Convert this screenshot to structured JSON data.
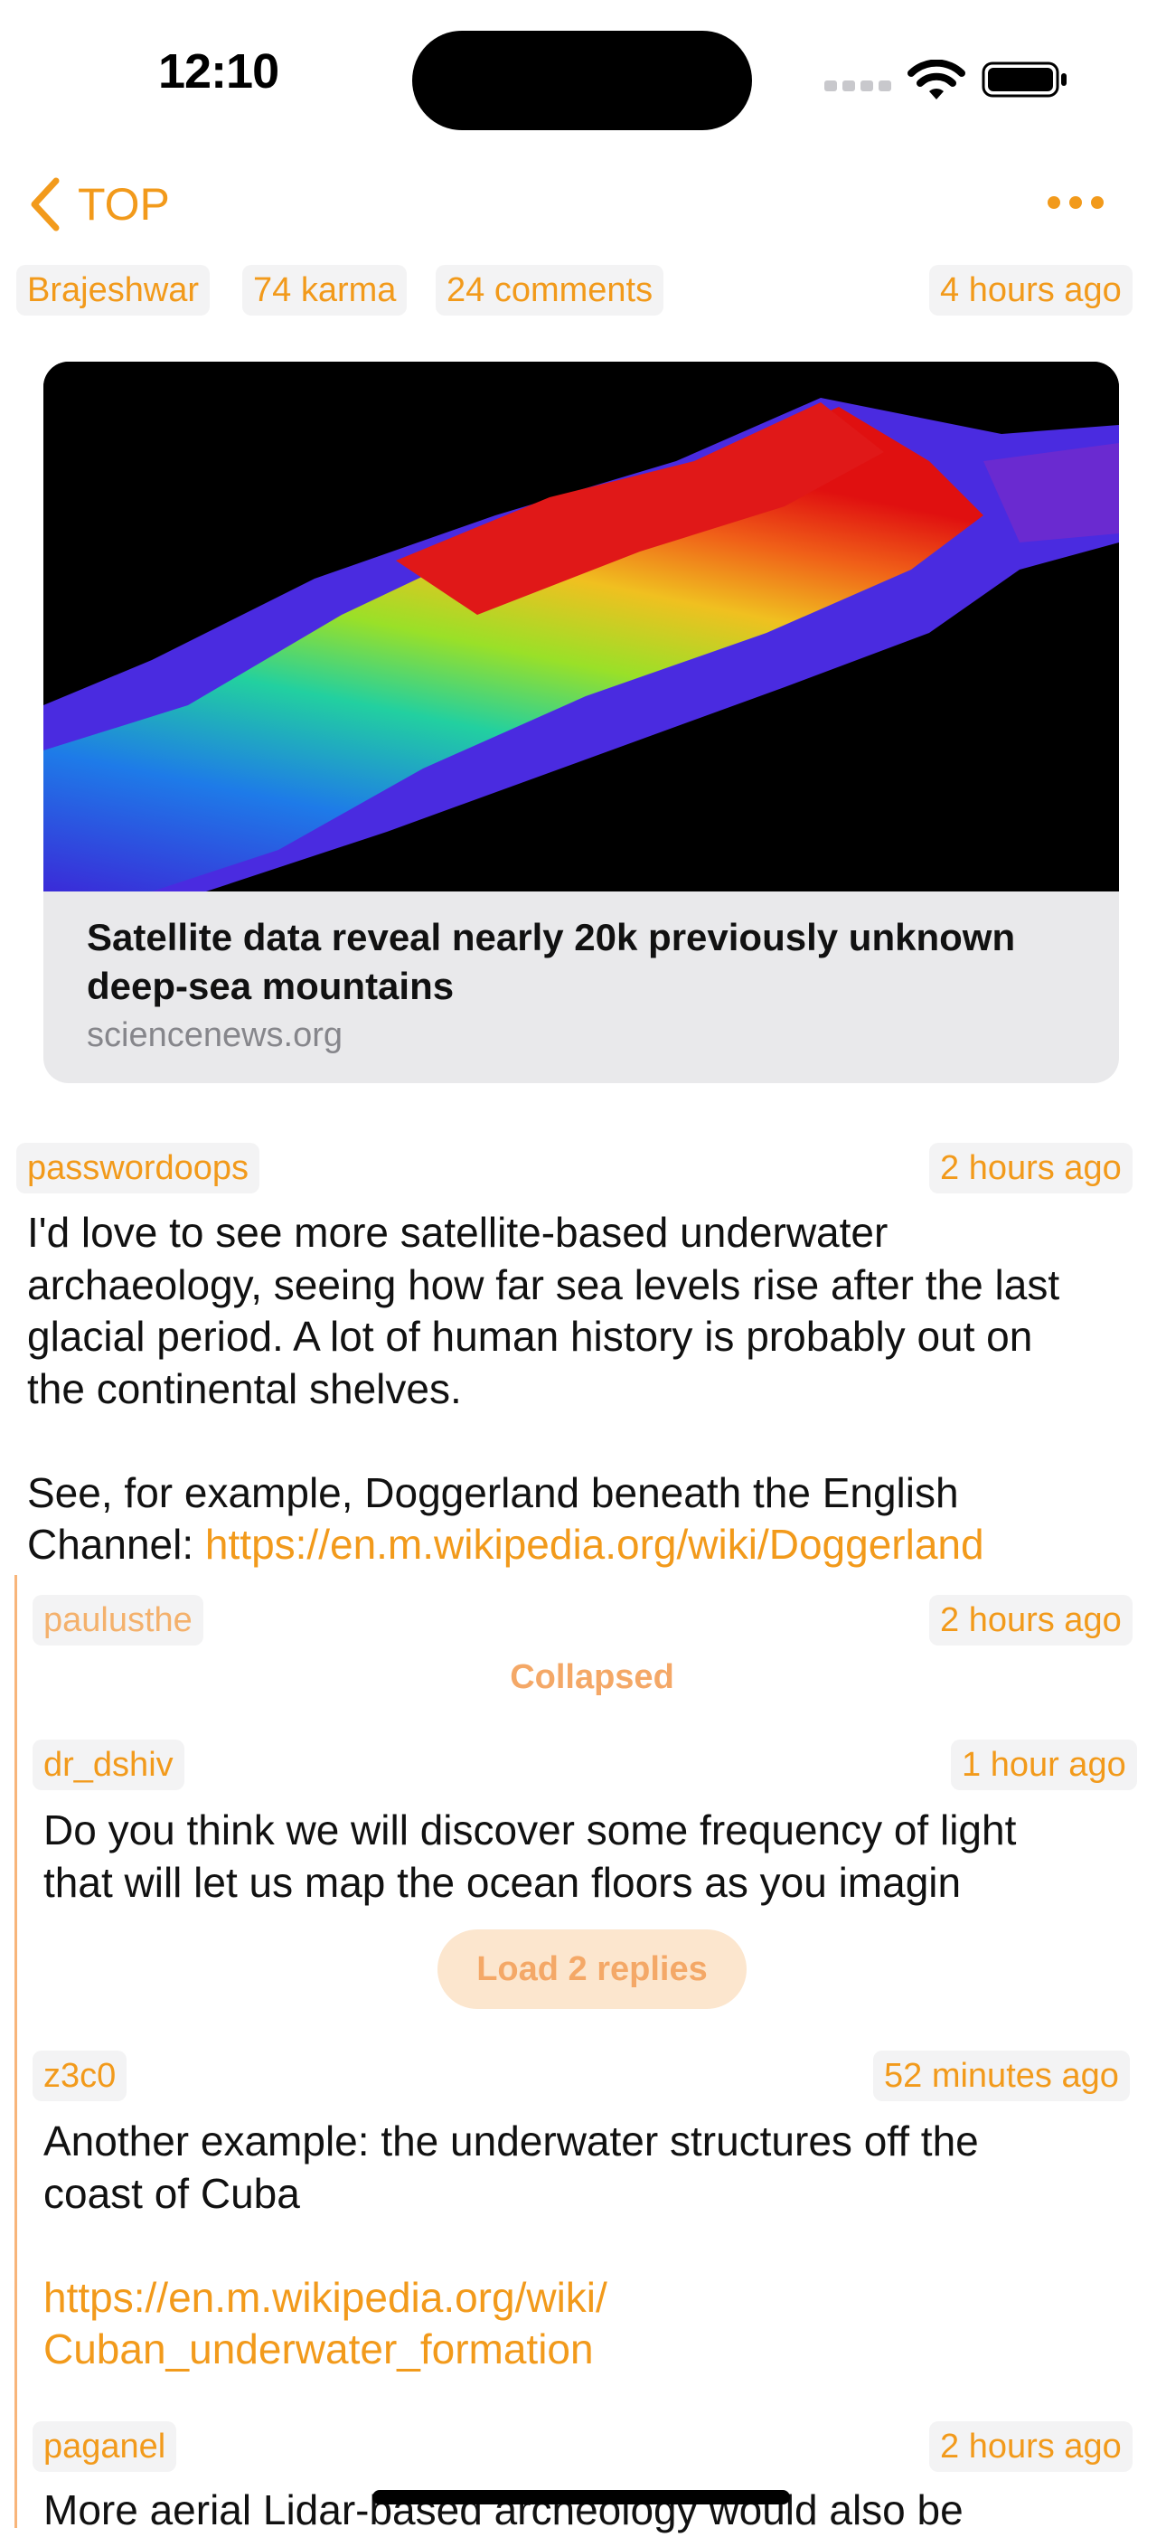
{
  "status_bar": {
    "time": "12:10"
  },
  "nav": {
    "back_label": "TOP"
  },
  "post": {
    "author": "Brajeshwar",
    "karma": "74 karma",
    "comments": "24 comments",
    "age": "4 hours ago",
    "link_title": "Satellite data reveal nearly 20k previously unknown deep-sea mountains",
    "link_domain": "sciencenews.org"
  },
  "comments": [
    {
      "author": "passwordoops",
      "age": "2 hours ago",
      "text_lines": [
        "I'd love to see more satellite-based underwater",
        "archaeology, seeing how far sea levels rise after the last",
        "glacial period. A lot of human history is probably out on",
        "the continental shelves.",
        "",
        "See, for example, Doggerland beneath the English"
      ],
      "last_line_prefix": "Channel: ",
      "link": "https://en.m.wikipedia.org/wiki/Doggerland"
    },
    {
      "author": "paulusthe",
      "age": "2 hours ago",
      "collapsed_label": "Collapsed"
    },
    {
      "author": "dr_dshiv",
      "age": "1 hour ago",
      "text_lines": [
        "Do you think we will discover some frequency of light",
        "that will let us map the ocean floors as you imagin"
      ],
      "load_replies_label": "Load 2 replies"
    },
    {
      "author": "z3c0",
      "age": "52 minutes ago",
      "text_lines": [
        "Another example: the underwater structures off the",
        "coast of Cuba"
      ],
      "link_lines": [
        "https://en.m.wikipedia.org/wiki/",
        "Cuban_underwater_formation"
      ]
    },
    {
      "author": "paganel",
      "age": "2 hours ago",
      "text_partial": "More aerial Lidar-based archeology would also be"
    }
  ],
  "colors": {
    "accent": "#F29A1B",
    "accent_muted": "#F4A867",
    "tag_bg": "#F3F3F4"
  }
}
